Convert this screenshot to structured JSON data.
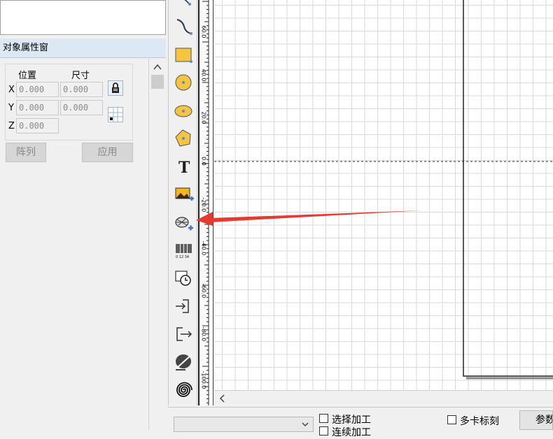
{
  "property_window": {
    "title": "对象属性窗",
    "position_label": "位置",
    "size_label": "尺寸",
    "x_label": "X",
    "y_label": "Y",
    "z_label": "Z",
    "x_pos": "0.000",
    "x_size": "0.000",
    "y_pos": "0.000",
    "y_size": "0.000",
    "z_pos": "0.000",
    "array_button": "阵列",
    "apply_button": "应用"
  },
  "toolbar": {
    "tools": [
      "curve-icon",
      "rectangle-icon",
      "circle-icon",
      "ellipse-icon",
      "polygon-icon",
      "text-icon",
      "bitmap-icon",
      "vector-file-icon",
      "barcode-icon",
      "timer-icon",
      "input-port-icon",
      "output-port-icon",
      "encoder-icon",
      "spiral-icon"
    ],
    "text_tool_glyph": "T",
    "barcode_digits": "0 12 34"
  },
  "ruler": {
    "labels": [
      "60.0",
      "40.0",
      "20.0",
      "0.0",
      "-20.0",
      "-40.0",
      "-60.0",
      "-80.0",
      "-100.0"
    ]
  },
  "bottom_bar": {
    "select_process": "选择加工",
    "continuous_process": "连续加工",
    "multi_card": "多卡标刻",
    "params": "参数"
  },
  "colors": {
    "arrow": "#e53a2f",
    "header_bg": "#dce8f4",
    "tool_yellow": "#f5c542"
  }
}
